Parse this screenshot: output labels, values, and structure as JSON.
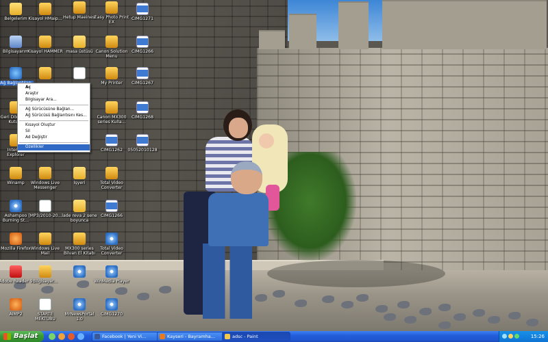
{
  "desktop_icons": [
    {
      "label": "Belgelerim",
      "icon": "folder-icon"
    },
    {
      "label": "Kisayol HMaip...",
      "icon": "app-icon"
    },
    {
      "label": "Hetup Maeinesi",
      "icon": "app-icon"
    },
    {
      "label": "Easy Photo Print EX",
      "icon": "app-icon"
    },
    {
      "label": "CIMG1271",
      "icon": "image-icon"
    },
    {
      "label": "Bilgisayarım",
      "icon": "computer-icon"
    },
    {
      "label": "Kisayol HAMMER",
      "icon": "app-icon"
    },
    {
      "label": "masa üstüsü",
      "icon": "folder-icon"
    },
    {
      "label": "Canon Solution Menu",
      "icon": "app-icon"
    },
    {
      "label": "CIMG1266",
      "icon": "image-icon"
    },
    {
      "label": "Ağ Bağlantıları",
      "icon": "network-icon"
    },
    {
      "label": "",
      "icon": "app-icon"
    },
    {
      "label": "",
      "icon": "doc-icon"
    },
    {
      "label": "My Printer",
      "icon": "app-icon"
    },
    {
      "label": "CIMG1267",
      "icon": "image-icon"
    },
    {
      "label": "Geri Dönüşüm Kutusu",
      "icon": "app-icon"
    },
    {
      "label": "Canon MX300 series Kulla...",
      "icon": "app-icon"
    },
    {
      "label": "CIMG1268",
      "icon": "image-icon"
    },
    {
      "label": "Internet Explorer",
      "icon": "app-icon"
    },
    {
      "label": "CIMG1262",
      "icon": "image-icon"
    },
    {
      "label": "05052010128",
      "icon": "image-icon"
    },
    {
      "label": "Winamp",
      "icon": "app-icon"
    },
    {
      "label": "Windows Live Messenger",
      "icon": "app-icon"
    },
    {
      "label": "Işyeri",
      "icon": "folder-icon"
    },
    {
      "label": "Total Video Converter",
      "icon": "app-icon"
    },
    {
      "label": "Ashampoo Burning St...",
      "icon": "cd-icon"
    },
    {
      "label": "[MP3/2010-20...",
      "icon": "doc-icon"
    },
    {
      "label": "lade reva 2 sene boyunca",
      "icon": "folder-icon"
    },
    {
      "label": "CIMG1266",
      "icon": "image-icon"
    },
    {
      "label": "Mozilla Firefox",
      "icon": "orange-icon"
    },
    {
      "label": "Windows Live Mail",
      "icon": "app-icon"
    },
    {
      "label": "MX300 series Bilvan El Kitabı",
      "icon": "app-icon"
    },
    {
      "label": "Total Video Converter",
      "icon": "cd-icon"
    },
    {
      "label": "Adobe Reader 9",
      "icon": "red-icon"
    },
    {
      "label": "Bilgisayar...",
      "icon": "app-icon"
    },
    {
      "label": "",
      "icon": "cd-icon"
    },
    {
      "label": "WinMedia Player",
      "icon": "cd-icon"
    },
    {
      "label": "AIMP2",
      "icon": "orange-icon"
    },
    {
      "label": "STARTE MEKTUBU",
      "icon": "doc-icon"
    },
    {
      "label": "MrNewsPortal 1.0",
      "icon": "cd-icon"
    },
    {
      "label": "CIMG1270",
      "icon": "cd-icon"
    }
  ],
  "context_menu": {
    "items": [
      {
        "label": "Aç",
        "bold": true
      },
      {
        "label": "Araştır"
      },
      {
        "label": "Bilgisayar Ara..."
      },
      {
        "sep": true
      },
      {
        "label": "Ağ Sürücüsüne Bağlan..."
      },
      {
        "label": "Ağ Sürücüsü Bağlantısını Kes..."
      },
      {
        "sep": true
      },
      {
        "label": "Kısayol Oluştur"
      },
      {
        "label": "Sil"
      },
      {
        "label": "Ad Değiştir"
      },
      {
        "sep": true
      },
      {
        "label": "Özellikler",
        "highlighted": true
      }
    ]
  },
  "taskbar": {
    "start_label": "Başlat",
    "tasks": [
      {
        "label": "Facebook | Yeni Vi...",
        "active": false
      },
      {
        "label": "Kayseri - Bayramha...",
        "active": false
      },
      {
        "label": "adsc - Paint",
        "active": true
      }
    ],
    "clock": "15:26"
  },
  "colors": {
    "taskbar_blue": "#245edb",
    "start_green": "#3a9a34",
    "selection_blue": "#316ac5"
  }
}
